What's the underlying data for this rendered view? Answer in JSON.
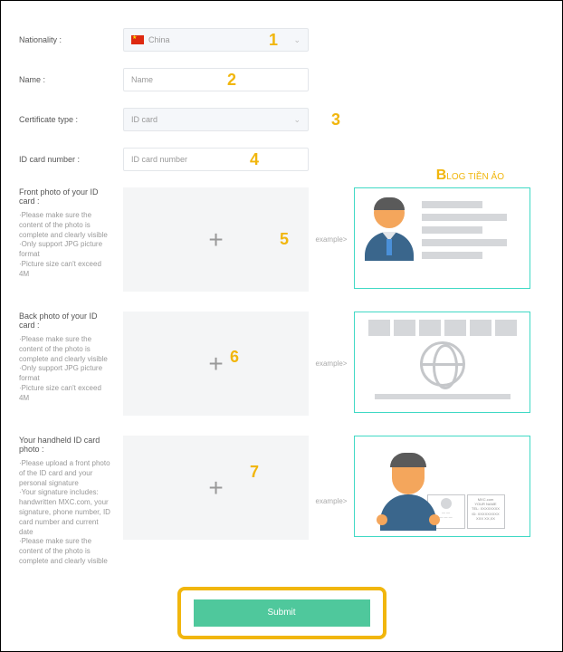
{
  "nationality": {
    "label": "Nationality :",
    "value": "China"
  },
  "name": {
    "label": "Name :",
    "placeholder": "Name"
  },
  "certType": {
    "label": "Certificate type :",
    "value": "ID card"
  },
  "idNumber": {
    "label": "ID card number :",
    "placeholder": "ID card number"
  },
  "annotations": {
    "a1": "1",
    "a2": "2",
    "a3": "3",
    "a4": "4",
    "a5": "5",
    "a6": "6",
    "a7": "7"
  },
  "watermark": "LOG TIỀN ẢO",
  "watermarkB": "B",
  "uploads": {
    "front": {
      "title": "Front photo of your ID card :",
      "hint": "·Please make sure the content of the photo is complete and clearly visible\n·Only support JPG picture format\n·Picture size can't exceed 4M"
    },
    "back": {
      "title": "Back photo of your ID card :",
      "hint": "·Please make sure the content of the photo is complete and clearly visible\n·Only support JPG picture format\n·Picture size can't exceed 4M"
    },
    "handheld": {
      "title": "Your handheld ID card photo :",
      "hint": "·Please upload a front photo of the ID card and your personal signature\n·Your signature includes: handwritten MXC.com, your signature, phone number, ID card number and current date\n·Please make sure the content of the photo is complete and clearly visible"
    }
  },
  "exampleText": "example>",
  "paperText": {
    "site": "MXC.com",
    "name": "YOUR NAME",
    "tel": "TEL: XXXXXXXX",
    "id": "ID: XXXXXXXXX",
    "date": "XXX XX,XX"
  },
  "submit": "Submit"
}
